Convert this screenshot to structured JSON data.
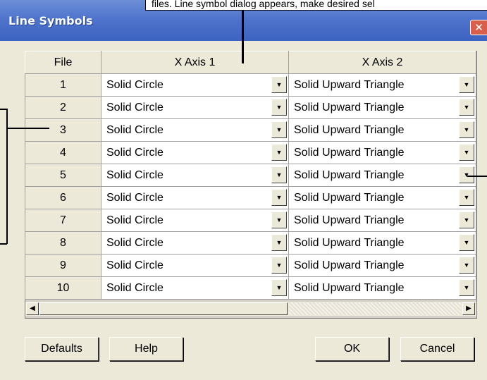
{
  "dialog": {
    "title": "Line Symbols",
    "close_glyph": "✕"
  },
  "callout_top": "files. Line symbol dialog appears, make desired sel",
  "grid": {
    "headers": [
      "File",
      "X Axis 1",
      "X Axis 2"
    ],
    "rows": [
      {
        "file": "1",
        "x1": "Solid Circle",
        "x2": "Solid Upward Triangle"
      },
      {
        "file": "2",
        "x1": "Solid Circle",
        "x2": "Solid Upward Triangle"
      },
      {
        "file": "3",
        "x1": "Solid Circle",
        "x2": "Solid Upward Triangle"
      },
      {
        "file": "4",
        "x1": "Solid Circle",
        "x2": "Solid Upward Triangle"
      },
      {
        "file": "5",
        "x1": "Solid Circle",
        "x2": "Solid Upward Triangle"
      },
      {
        "file": "6",
        "x1": "Solid Circle",
        "x2": "Solid Upward Triangle"
      },
      {
        "file": "7",
        "x1": "Solid Circle",
        "x2": "Solid Upward Triangle"
      },
      {
        "file": "8",
        "x1": "Solid Circle",
        "x2": "Solid Upward Triangle"
      },
      {
        "file": "9",
        "x1": "Solid Circle",
        "x2": "Solid Upward Triangle"
      },
      {
        "file": "10",
        "x1": "Solid Circle",
        "x2": "Solid Upward Triangle"
      }
    ],
    "dropdown_glyph": "▼",
    "scroll_left_glyph": "◀",
    "scroll_right_glyph": "▶"
  },
  "buttons": {
    "defaults": "Defaults",
    "help": "Help",
    "ok": "OK",
    "cancel": "Cancel"
  }
}
